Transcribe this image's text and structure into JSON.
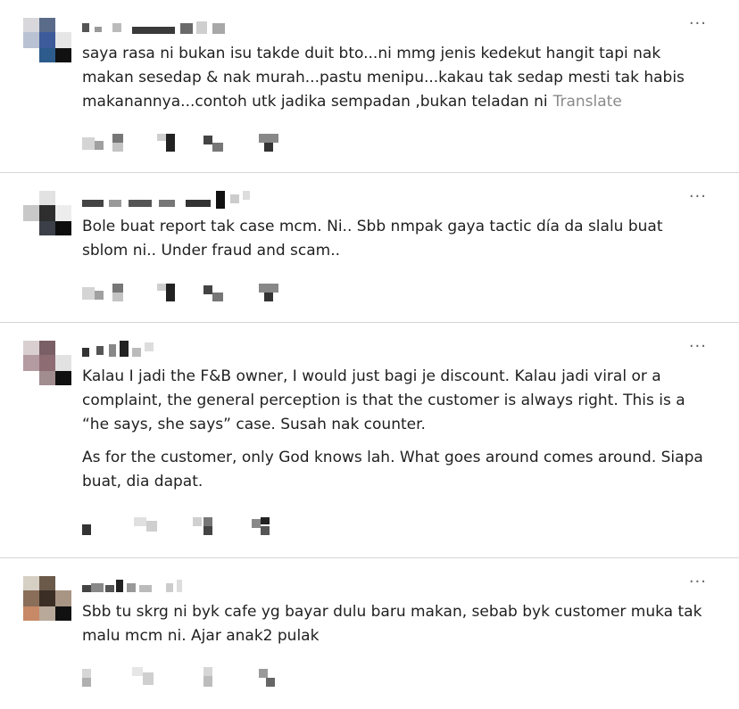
{
  "comments": [
    {
      "paragraphs": [
        "saya rasa ni bukan isu takde duit bto...ni mmg jenis kedekut hangit tapi nak makan sesedap & nak murah...pastu menipu...kakau tak sedap mesti tak habis makanannya...contoh utk jadika sempadan ,bukan teladan ni"
      ],
      "translate_label": "Translate",
      "more_icon": "more-horizontal-icon"
    },
    {
      "paragraphs": [
        "Bole buat report tak case mcm. Ni.. Sbb nmpak gaya tactic día da slalu buat sblom ni.. Under fraud and scam.."
      ],
      "more_icon": "more-horizontal-icon"
    },
    {
      "paragraphs": [
        "Kalau I jadi the F&B owner, I would just bagi je discount. Kalau jadi viral or a complaint, the general perception is that the customer is always right. This is a “he says, she says” case. Susah nak counter.",
        "As for the customer, only God knows lah. What goes around comes around. Siapa buat, dia dapat."
      ],
      "more_icon": "more-horizontal-icon"
    },
    {
      "paragraphs": [
        "Sbb tu skrg ni byk cafe yg bayar dulu baru makan, sebab byk customer muka tak malu mcm ni. Ajar anak2 pulak"
      ],
      "more_icon": "more-horizontal-icon"
    }
  ],
  "more_glyph": "···",
  "colors": {
    "text": "#1f1f1f",
    "translate": "#8a8a8a",
    "divider": "#d6d6d6",
    "pixelation": [
      "#111111",
      "#2a2a2a",
      "#6b6b6b",
      "#9a9a9a",
      "#c8c8c8",
      "#e2e2e2"
    ]
  }
}
